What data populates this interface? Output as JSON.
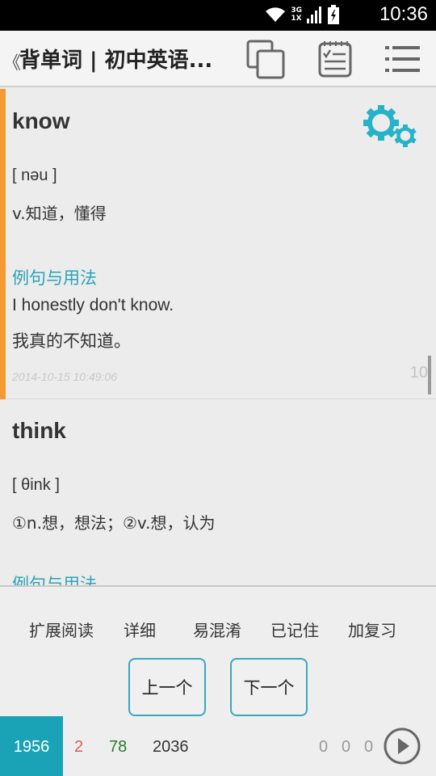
{
  "status_bar": {
    "time": "10:36",
    "network_top": "3G",
    "network_bottom": "1X"
  },
  "action_bar": {
    "back_glyph": "《",
    "title": "背单词 | 初中英语..."
  },
  "cards": [
    {
      "word": "know",
      "phonetic": "[ nəu ]",
      "meaning": "v.知道，懂得",
      "section_title": "例句与用法",
      "example": "I honestly don't know.",
      "translation": "我真的不知道。",
      "timestamp": "2014-10-15 10:49:06",
      "count": "10"
    },
    {
      "word": "think",
      "phonetic": "[ θink ]",
      "meaning": "①n.想，想法；②v.想，认为",
      "section_title": "例句与用法"
    }
  ],
  "menu": {
    "extended_reading": "扩展阅读",
    "detail": "详细",
    "confusable": "易混淆",
    "memorized": "已记住",
    "add_review": "加复习"
  },
  "nav": {
    "prev": "上一个",
    "next": "下一个"
  },
  "stats": {
    "total": "1956",
    "red": "2",
    "green": "78",
    "count": "2036",
    "z1": "0",
    "z2": "0",
    "z3": "0"
  },
  "colors": {
    "accent": "#1aa3b6",
    "highlight": "#f59a33",
    "section": "#2aa4b4",
    "red": "#e05a5a",
    "green": "#2a7a2a"
  },
  "icons": [
    "wifi-icon",
    "signal-icon",
    "battery-icon",
    "copy-icon",
    "checklist-icon",
    "menu-icon",
    "gear-icon",
    "play-icon"
  ]
}
